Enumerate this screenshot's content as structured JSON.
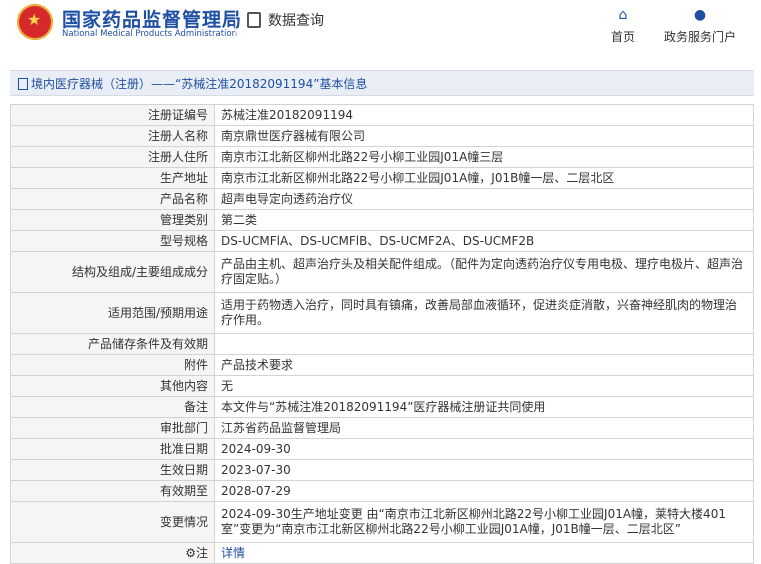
{
  "header": {
    "logo_cn": "国家药品监督管理局",
    "logo_en": "National Medical Products Administration",
    "section": "数据查询",
    "nav_home": "首页",
    "nav_service": "政务服务门户"
  },
  "banner": {
    "text": "境内医疗器械（注册）——“苏械注准20182091194”基本信息"
  },
  "rows": [
    {
      "label": "注册证编号",
      "value": "苏械注准20182091194"
    },
    {
      "label": "注册人名称",
      "value": "南京鼎世医疗器械有限公司"
    },
    {
      "label": "注册人住所",
      "value": "南京市江北新区柳州北路22号小柳工业园J01A幢三层"
    },
    {
      "label": "生产地址",
      "value": "南京市江北新区柳州北路22号小柳工业园J01A幢，J01B幢一层、二层北区"
    },
    {
      "label": "产品名称",
      "value": "超声电导定向透药治疗仪"
    },
    {
      "label": "管理类别",
      "value": "第二类"
    },
    {
      "label": "型号规格",
      "value": "DS-UCMFlA、DS-UCMFlB、DS-UCMF2A、DS-UCMF2B"
    },
    {
      "label": "结构及组成/主要组成成分",
      "value": "产品由主机、超声治疗头及相关配件组成。（配件为定向透药治疗仪专用电极、理疗电极片、超声治疗固定贴。）"
    },
    {
      "label": "适用范围/预期用途",
      "value": "适用于药物透入治疗，同时具有镇痛，改善局部血液循环，促进炎症消散，兴奋神经肌肉的物理治疗作用。"
    },
    {
      "label": "产品储存条件及有效期",
      "value": ""
    },
    {
      "label": "附件",
      "value": "产品技术要求"
    },
    {
      "label": "其他内容",
      "value": "无"
    },
    {
      "label": "备注",
      "value": "本文件与“苏械注准20182091194”医疗器械注册证共同使用"
    },
    {
      "label": "审批部门",
      "value": "江苏省药品监督管理局"
    },
    {
      "label": "批准日期",
      "value": "2024-09-30"
    },
    {
      "label": "生效日期",
      "value": "2023-07-30"
    },
    {
      "label": "有效期至",
      "value": "2028-07-29"
    },
    {
      "label": "变更情况",
      "value": "2024-09-30生产地址变更 由“南京市江北新区柳州北路22号小柳工业园J01A幢，莱特大楼401室”变更为“南京市江北新区柳州北路22号小柳工业园J01A幢，J01B幢一层、二层北区”"
    }
  ],
  "note": {
    "label": "注",
    "value": "详情",
    "icon": "gear-icon"
  }
}
